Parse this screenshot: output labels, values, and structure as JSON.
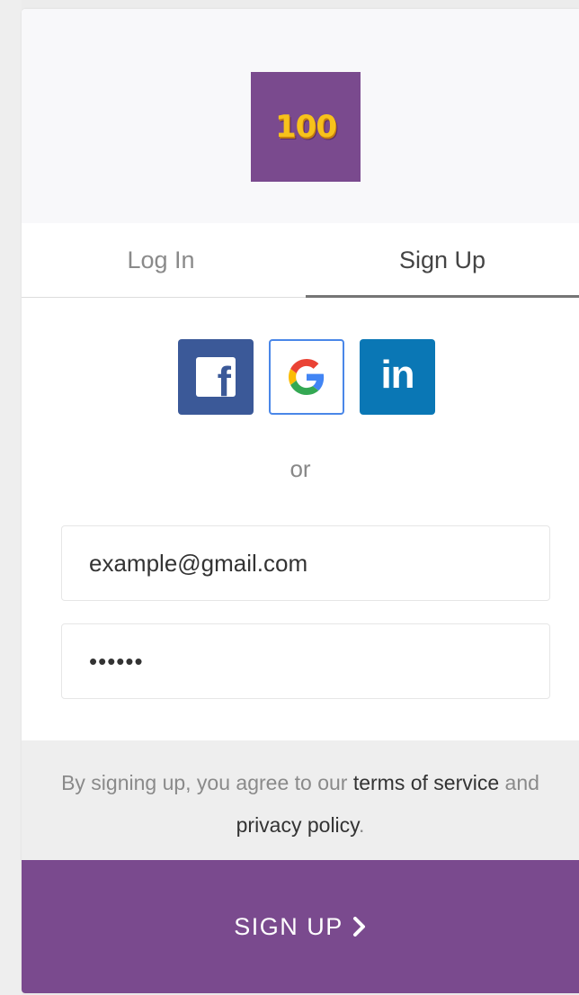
{
  "logo": {
    "text": "100"
  },
  "tabs": [
    {
      "label": "Log In",
      "active": false
    },
    {
      "label": "Sign Up",
      "active": true
    }
  ],
  "social": [
    {
      "name": "Facebook",
      "icon": "facebook-icon"
    },
    {
      "name": "Google",
      "icon": "google-icon"
    },
    {
      "name": "LinkedIn",
      "icon": "linkedin-icon",
      "text": "in"
    }
  ],
  "separator": "or",
  "form": {
    "email_value": "example@gmail.com",
    "password_value": "••••••"
  },
  "terms": {
    "prefix": "By signing up, you agree to our ",
    "link1": "terms of service",
    "middle": " and",
    "link2": "privacy policy",
    "suffix": "."
  },
  "submit": {
    "label": "SIGN UP",
    "icon": "chevron-right-icon"
  },
  "colors": {
    "brand_purple": "#7a4a8e",
    "logo_yellow": "#f7c21b",
    "facebook_blue": "#3b5998",
    "linkedin_blue": "#0a77b5",
    "google_border": "#4a87e8"
  }
}
